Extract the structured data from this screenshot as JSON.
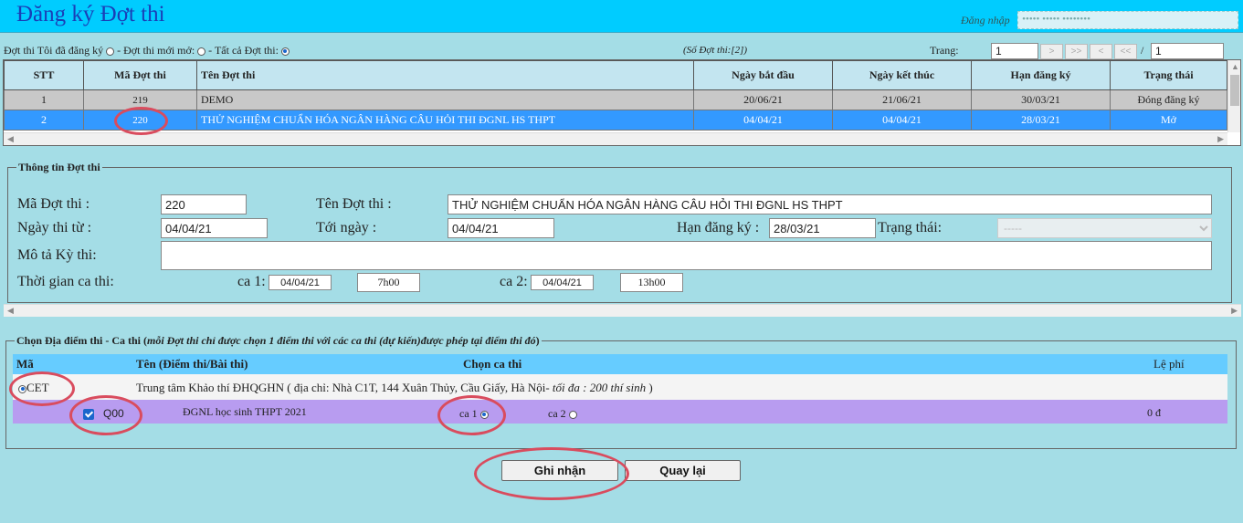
{
  "header": {
    "title": "Đăng ký Đợt thi",
    "login_label": "Đăng nhập",
    "login_value": "••••• ••••• ••••••••"
  },
  "filter": {
    "mine": "Đợt thi Tôi đã đăng ký",
    "new": "- Đợt thi mới mở:",
    "all": "- Tất cả Đợt thi:",
    "selected": "all"
  },
  "count_text": "(Số Đợt thi:[2])",
  "pager": {
    "label": "Trang:",
    "current": "1",
    "total": "1",
    "separator": "/",
    "buttons": [
      ">",
      ">>",
      "<",
      "<<"
    ]
  },
  "grid": {
    "columns": [
      "STT",
      "Mã Đợt thi",
      "Tên Đợt thi",
      "Ngày bắt đầu",
      "Ngày kết thúc",
      "Hạn đăng ký",
      "Trạng thái"
    ],
    "rows": [
      {
        "stt": "1",
        "ma": "219",
        "ten": "DEMO",
        "bat_dau": "20/06/21",
        "ket_thuc": "21/06/21",
        "han": "30/03/21",
        "trang_thai": "Đóng đăng ký"
      },
      {
        "stt": "2",
        "ma": "220",
        "ten": "THỬ NGHIỆM CHUẨN HÓA NGÂN HÀNG CÂU HỎI THI ĐGNL HS THPT",
        "bat_dau": "04/04/21",
        "ket_thuc": "04/04/21",
        "han": "28/03/21",
        "trang_thai": "Mở"
      }
    ],
    "selected_row": 2
  },
  "info": {
    "legend": "Thông tin Đợt thi",
    "ma_label": "Mã Đợt thi :",
    "ma_value": "220",
    "ten_label": "Tên Đợt thi :",
    "ten_value": "THỬ NGHIỆM CHUẨN HÓA NGÂN HÀNG CÂU HỎI THI ĐGNL HS THPT",
    "tu_label": "Ngày thi từ :",
    "tu_value": "04/04/21",
    "toi_label": "Tới ngày :",
    "toi_value": "04/04/21",
    "han_label": "Hạn đăng ký :",
    "han_value": "28/03/21",
    "tt_label": "Trạng thái:",
    "tt_value": "-----",
    "mota_label": "Mô tả Kỳ thi:",
    "mota_value": "",
    "tg_label": "Thời gian ca thi:",
    "ca1_label": "ca 1:",
    "ca1_date": "04/04/21",
    "ca1_time": "7h00",
    "ca2_label": "ca 2:",
    "ca2_date": "04/04/21",
    "ca2_time": "13h00"
  },
  "location": {
    "legend_prefix": "Chọn Địa điểm thi - Ca thi (",
    "legend_note": "mỗi Đợt thi chỉ được chọn 1 điểm thi với các ca thi (dự kiến)được phép tại điểm thi đó",
    "legend_suffix": ")",
    "columns": {
      "ma": "Mã",
      "ten": "Tên (Điểm thi/Bài thi)",
      "ca": "Chọn ca thi",
      "phi": "Lệ phí"
    },
    "site": {
      "code": "CET",
      "name_prefix": "Trung tâm Khảo thí ĐHQGHN ( địa chỉ: Nhà C1T, 144 Xuân Thủy, Cầu Giấy, Hà Nội-",
      "name_note": " tối đa : 200 thí sinh",
      "name_suffix": " )"
    },
    "exam": {
      "code": "Q00",
      "name": "ĐGNL học sinh THPT 2021",
      "ca1": "ca 1",
      "ca2": "ca 2",
      "selected_ca": "ca 1",
      "fee": "0 đ"
    }
  },
  "buttons": {
    "submit": "Ghi nhận",
    "back": "Quay lại"
  },
  "colors": {
    "header": "#00ccff",
    "title": "#1a3fb7",
    "selected_row": "#3399ff",
    "highlight": "#d94c5e",
    "exam_row": "#b89cf0"
  }
}
